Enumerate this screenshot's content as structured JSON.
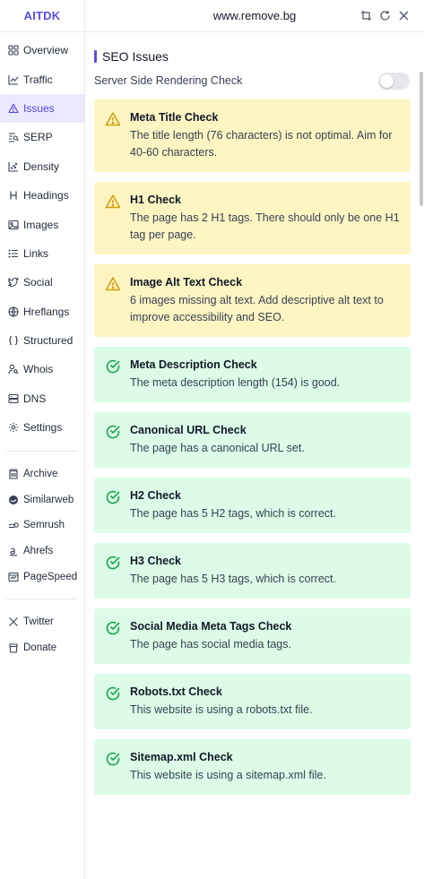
{
  "brand": "AITDK",
  "domain": "www.remove.bg",
  "nav": [
    {
      "label": "Overview",
      "icon": "grid-icon"
    },
    {
      "label": "Traffic",
      "icon": "chart-line-icon"
    },
    {
      "label": "Issues",
      "icon": "warning-icon",
      "active": true
    },
    {
      "label": "SERP",
      "icon": "serp-icon"
    },
    {
      "label": "Density",
      "icon": "density-icon"
    },
    {
      "label": "Headings",
      "icon": "heading-icon"
    },
    {
      "label": "Images",
      "icon": "image-icon"
    },
    {
      "label": "Links",
      "icon": "list-icon"
    },
    {
      "label": "Social",
      "icon": "twitter-bird-icon"
    },
    {
      "label": "Hreflangs",
      "icon": "globe-icon"
    },
    {
      "label": "Structured",
      "icon": "braces-icon"
    },
    {
      "label": "Whois",
      "icon": "user-search-icon"
    },
    {
      "label": "DNS",
      "icon": "server-icon"
    },
    {
      "label": "Settings",
      "icon": "gear-icon"
    }
  ],
  "external_tools": [
    {
      "label": "Archive",
      "icon": "archive-icon"
    },
    {
      "label": "Similarweb",
      "icon": "similarweb-icon"
    },
    {
      "label": "Semrush",
      "icon": "semrush-icon"
    },
    {
      "label": "Ahrefs",
      "icon": "ahrefs-icon"
    },
    {
      "label": "PageSpeed",
      "icon": "pagespeed-icon"
    }
  ],
  "social_links": [
    {
      "label": "Twitter",
      "icon": "x-logo-icon"
    },
    {
      "label": "Donate",
      "icon": "cup-icon"
    }
  ],
  "section_title": "SEO Issues",
  "ssr_label": "Server Side Rendering Check",
  "ssr_enabled": false,
  "status_colors": {
    "warning_bg": "#fef5c3",
    "ok_bg": "#dcfce7",
    "accent": "#5b4fe6"
  },
  "checks": [
    {
      "status": "warning",
      "title": "Meta Title Check",
      "desc": "The title length (76 characters) is not optimal. Aim for 40-60 characters."
    },
    {
      "status": "warning",
      "title": "H1 Check",
      "desc": "The page has 2 H1 tags. There should only be one H1 tag per page."
    },
    {
      "status": "warning",
      "title": "Image Alt Text Check",
      "desc": "6 images missing alt text. Add descriptive alt text to improve accessibility and SEO."
    },
    {
      "status": "ok",
      "title": "Meta Description Check",
      "desc": "The meta description length (154) is good."
    },
    {
      "status": "ok",
      "title": "Canonical URL Check",
      "desc": "The page has a canonical URL set."
    },
    {
      "status": "ok",
      "title": "H2 Check",
      "desc": "The page has 5 H2 tags, which is correct."
    },
    {
      "status": "ok",
      "title": "H3 Check",
      "desc": "The page has 5 H3 tags, which is correct."
    },
    {
      "status": "ok",
      "title": "Social Media Meta Tags Check",
      "desc": "The page has social media tags."
    },
    {
      "status": "ok",
      "title": "Robots.txt Check",
      "desc": "This website is using a robots.txt file."
    },
    {
      "status": "ok",
      "title": "Sitemap.xml Check",
      "desc": "This website is using a sitemap.xml file."
    }
  ]
}
